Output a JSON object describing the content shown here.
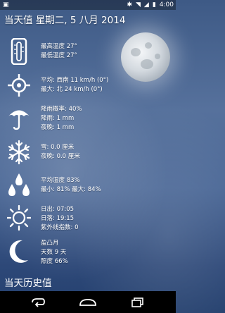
{
  "status_bar": {
    "icons": [
      "notification-icon",
      "bluetooth-icon",
      "wifi-icon",
      "signal-icon",
      "battery-icon"
    ],
    "time": "4:00"
  },
  "header": {
    "title": "当天值 星期二, 5 八月 2014"
  },
  "temperature": {
    "high": "最高温度 27°",
    "low": "最低温度 27°"
  },
  "wind": {
    "average": "平均: 西南 11 km/h (0°)",
    "max": "最大: 北 24 km/h (0°)"
  },
  "precipitation": {
    "probability": "降雨概率: 40%",
    "rain": "降雨: 1 mm",
    "night": "夜晚: 1 mm"
  },
  "snow": {
    "day": "雪: 0.0 厘米",
    "night": "夜晚: 0.0 厘米"
  },
  "humidity": {
    "average": "平均湿度 83%",
    "minmax": "最小: 81% 最大: 84%"
  },
  "sun": {
    "sunrise": "日出: 07:05",
    "sunset": "日落: 19:15",
    "uv": "紫外线指数: 0"
  },
  "moon": {
    "phase": "盈凸月",
    "days": "天数 9 天",
    "illumination": "照度 66%"
  },
  "history": {
    "title": "当天历史值"
  },
  "nav": {
    "back": "back-icon",
    "home": "home-icon",
    "recents": "recents-icon"
  },
  "colors": {
    "sky_top": "#3e5a86",
    "sky_bottom": "#24406e",
    "text": "#ffffff"
  }
}
